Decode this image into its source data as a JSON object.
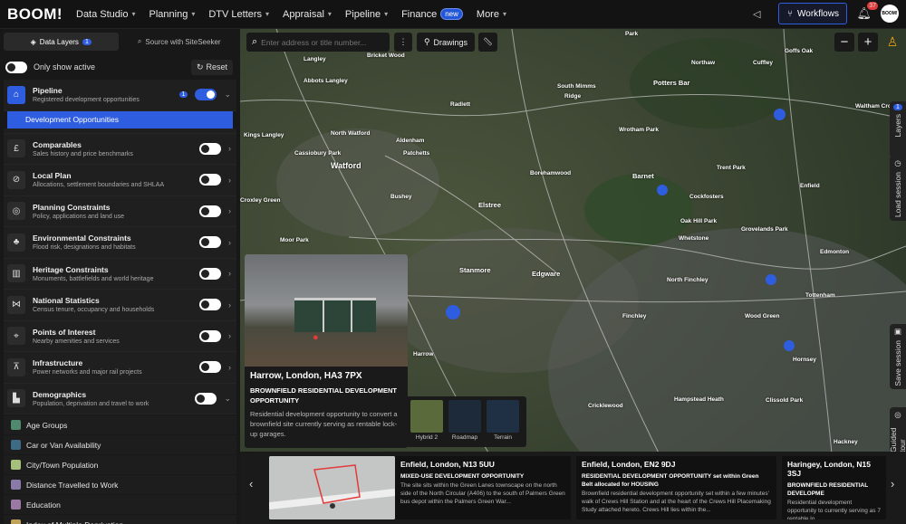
{
  "nav": {
    "logo": "BOOM!",
    "items": [
      {
        "label": "Data Studio",
        "chevron": true
      },
      {
        "label": "Planning",
        "chevron": true
      },
      {
        "label": "DTV Letters",
        "chevron": true
      },
      {
        "label": "Appraisal",
        "chevron": true
      },
      {
        "label": "Pipeline",
        "chevron": true
      },
      {
        "label": "Finance",
        "badge": "new",
        "chevron": false
      },
      {
        "label": "More",
        "chevron": true
      }
    ],
    "workflows_label": "Workflows",
    "notifications_count": "37",
    "avatar_text": "BOOM!"
  },
  "sidebar": {
    "tab_layers": "Data Layers",
    "tab_layers_count": "1",
    "tab_source": "Source with SiteSeeker",
    "only_active_label": "Only show active",
    "reset_label": "Reset",
    "pipeline": {
      "title": "Pipeline",
      "subtitle": "Registered development opportunities",
      "count": "1",
      "sub_item": "Development Opportunities"
    },
    "layers": [
      {
        "title": "Comparables",
        "subtitle": "Sales history and price benchmarks",
        "icon": "pound-icon"
      },
      {
        "title": "Local Plan",
        "subtitle": "Allocations, settlement boundaries and SHLAA",
        "icon": "compass-icon"
      },
      {
        "title": "Planning Constraints",
        "subtitle": "Policy, applications and land use",
        "icon": "target-icon"
      },
      {
        "title": "Environmental Constraints",
        "subtitle": "Flood risk, designations and habitats",
        "icon": "tree-icon"
      },
      {
        "title": "Heritage Constraints",
        "subtitle": "Monuments, battlefields and world heritage",
        "icon": "building-icon"
      },
      {
        "title": "National Statistics",
        "subtitle": "Census tenure, occupancy and households",
        "icon": "share-icon"
      },
      {
        "title": "Points of Interest",
        "subtitle": "Nearby amenities and services",
        "icon": "pin-icon"
      },
      {
        "title": "Infrastructure",
        "subtitle": "Power networks and major rail projects",
        "icon": "pylon-icon"
      },
      {
        "title": "Demographics",
        "subtitle": "Population, deprivation and travel to work",
        "icon": "chart-icon"
      }
    ],
    "demographics_items": [
      {
        "label": "Age Groups",
        "color": "#4f8a6e"
      },
      {
        "label": "Car or Van Availability",
        "color": "#3d6b85"
      },
      {
        "label": "City/Town Population",
        "color": "#a5c07a"
      },
      {
        "label": "Distance Travelled to Work",
        "color": "#8a7aa8"
      },
      {
        "label": "Education",
        "color": "#9a7aa5"
      },
      {
        "label": "Index of Multiple Deprivation",
        "color": "#c0a25a"
      }
    ]
  },
  "map": {
    "search_placeholder": "Enter address or title number...",
    "drawings_label": "Drawings",
    "zoom_out": "−",
    "zoom_in": "+",
    "labels": [
      "Langley",
      "Bricket Wood",
      "Park",
      "Northaw",
      "Cuffley",
      "Goffs Oak",
      "Abbots Langley",
      "Potters Bar",
      "South Mimms",
      "Ridge",
      "Radlett",
      "Wrotham Park",
      "Waltham Cross",
      "Kings Langley",
      "North Watford",
      "Aldenham",
      "Barnet",
      "Trent Park",
      "Cassiobury Park",
      "Watford",
      "Patchetts",
      "Borehamwood",
      "Enfield",
      "Croxley Green",
      "Bushey",
      "Elstree",
      "Cockfosters",
      "Moor Park",
      "Stanmore",
      "Oak Hill Park",
      "Whetstone",
      "Grovelands Park",
      "Edgware",
      "North Finchley",
      "Edmonton",
      "Tottenham",
      "Harrow",
      "Finchley",
      "Wood Green",
      "Hampstead Heath",
      "Hornsey",
      "Cricklewood",
      "Clissold Park",
      "Hackney"
    ],
    "popup": {
      "address": "Harrow, London, HA3 7PX",
      "kind": "BROWNFIELD RESIDENTIAL DEVELOPMENT OPPORTUNITY",
      "description": "Residential development opportunity to convert a brownfield site currently serving as rentable lock-up garages."
    },
    "map_types": [
      "Hybrid 2",
      "Roadmap",
      "Terrain"
    ],
    "side_tabs": {
      "layers": "Layers",
      "layers_count": "1",
      "load_session": "Load session",
      "save_session": "Save session",
      "guided_tour": "Guided tour"
    },
    "cards": [
      {
        "address": "Enfield, London, N13 5UU",
        "kind": "MIXED-USE DEVELOPMENT OPPORTUNITY",
        "description": "The site sits within the Green Lanes townscape on the north side of the North Circular (A406) to the south of Palmers Green bus depot within the Palmers Green War..."
      },
      {
        "address": "Enfield, London, EN2 9DJ",
        "kind": "RESIDENTIAL DEVELOPMENT OPPORTUNITY set within Green Belt allocated for HOUSING",
        "description": "Brownfield residential development opportunity set within a few minutes' walk of Crews Hill Station and at the heart of the Crews Hill Placemaking Study attached hereto. Crews Hill lies within the..."
      },
      {
        "address": "Haringey, London, N15 3SJ",
        "kind": "BROWNFIELD RESIDENTIAL DEVELOPME",
        "description": "Residential development opportunity to currently serving as 7 rentable lo"
      }
    ]
  }
}
